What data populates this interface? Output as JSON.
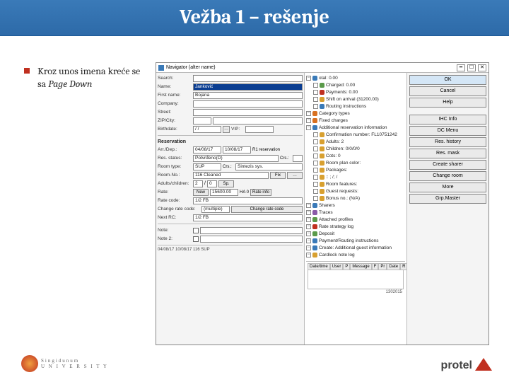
{
  "slide": {
    "title": "Vežba 1 – rešenje"
  },
  "bullet": {
    "line1": "Kroz unos imena kreće se sa ",
    "em": "Page Down"
  },
  "app": {
    "title": "Navigator (alter name)",
    "wc_min": "━",
    "wc_max": "☐",
    "wc_close": "✕",
    "form": {
      "search_lbl": "Search:",
      "name_lbl": "Name:",
      "name_val": "Janković",
      "first_lbl": "First name:",
      "first_val": "Bojana",
      "company_lbl": "Company:",
      "street_lbl": "Street:",
      "zip_lbl": "ZIP/City:",
      "birth_lbl": "Birthdate:",
      "birth_val": "  /  /",
      "vip_lbl": "VIP:",
      "res_hdr": "Reservation",
      "arr_lbl": "Arr./Dep.:",
      "arr1": "04/08/17",
      "arr2": "10/08/17",
      "rt_lbl": "R1 reservation",
      "status_lbl": "Res. status:",
      "status_val": "Potvrđeno(D)",
      "crs_lbl": "Crs.:",
      "roomtype_lbl": "Room type:",
      "roomtype_val": "SUP",
      "crs2_lbl": "Crs.:",
      "crs2_val": "Sintezis sys.",
      "roomno_lbl": "Room-No.:",
      "roomno_val": "116 Cleaned",
      "fix_lbl": "Fix",
      "fix_dots": "…",
      "adults_lbl": "Adults/children:",
      "adults_val": "2",
      "ch_val": "0",
      "sp_lbl": "Sp.",
      "rate_lbl": "Rate:",
      "rate_new": "New",
      "rate_amt": "15600.00",
      "rateinfo": "Rate info",
      "ha_lbl": "HA 0",
      "ratecode_lbl": "Rate code:",
      "ratecode_val": "1/2 FB",
      "chgcode_lbl": "Change rate code:",
      "chgcode_val": "(multiple)",
      "chgbtn": "Change rate code",
      "nextrc_lbl": "Next RC:",
      "nextrc_val": "1/2 FB",
      "note_lbl": "Note:",
      "note2_lbl": "Note 2:",
      "footer": "04/08/17  10/08/17  116 SUP"
    },
    "tree": [
      {
        "ic": "ic-b",
        "t": "otal: 0.00"
      },
      {
        "ic": "ic-g",
        "t": "Charged: 0.00",
        "l": 1
      },
      {
        "ic": "ic-r",
        "t": "Payments: 0.00",
        "l": 1
      },
      {
        "ic": "ic-y",
        "t": "Shift on arrival (31200.00)",
        "l": 1
      },
      {
        "ic": "ic-b",
        "t": "Routing instructions",
        "l": 1
      },
      {
        "ic": "ic-o",
        "t": "Category types"
      },
      {
        "ic": "ic-o",
        "t": "Fixed charges"
      },
      {
        "ic": "ic-b",
        "t": "Additional reservation information"
      },
      {
        "ic": "ic-y",
        "t": "Confirmation number: FL10751242",
        "l": 1
      },
      {
        "ic": "ic-y",
        "t": "Adults: 2",
        "l": 1
      },
      {
        "ic": "ic-y",
        "t": "Children: 0/0/0/0",
        "l": 1
      },
      {
        "ic": "ic-y",
        "t": "Cots: 0",
        "l": 1
      },
      {
        "ic": "ic-y",
        "t": "Room plan color:",
        "l": 1
      },
      {
        "ic": "ic-y",
        "t": "Packages:",
        "l": 1
      },
      {
        "ic": "ic-y",
        "t": ":: ; /; /",
        "l": 1
      },
      {
        "ic": "ic-y",
        "t": "Room features:",
        "l": 1
      },
      {
        "ic": "ic-y",
        "t": "Guest requests:",
        "l": 1
      },
      {
        "ic": "ic-y",
        "t": "Bonus no.: (N/A)",
        "l": 1
      },
      {
        "ic": "ic-b",
        "t": "Sharers"
      },
      {
        "ic": "ic-p",
        "t": "Traces"
      },
      {
        "ic": "ic-g",
        "t": "Attached profiles"
      },
      {
        "ic": "ic-r",
        "t": "Rate strategy log"
      },
      {
        "ic": "ic-g",
        "t": "Deposit"
      },
      {
        "ic": "ic-b",
        "t": "Payment/Routing instructions"
      },
      {
        "ic": "ic-b",
        "t": "Create: Additional guest information"
      },
      {
        "ic": "ic-y",
        "t": "Cardlock note log"
      }
    ],
    "buttons": {
      "ok": "OK",
      "cancel": "Cancel",
      "help": "Help",
      "ihcinfo": "IHC Info",
      "dcmenu": "DC Menu",
      "reshist": "Res. history",
      "resmask": "Res. mask",
      "create": "Create sharer",
      "changeroom": "Change room",
      "more": "More",
      "grpmaster": "Grp.Master"
    },
    "grid": {
      "cols": [
        "Date/time",
        "User",
        "P",
        "Message",
        "F",
        "Pr",
        "Date",
        "R"
      ],
      "footer": "1302015"
    }
  },
  "logos": {
    "singidunum": "Singidunum",
    "singidunum_sub": "U N I V E R S I T Y",
    "protel": "protel"
  }
}
